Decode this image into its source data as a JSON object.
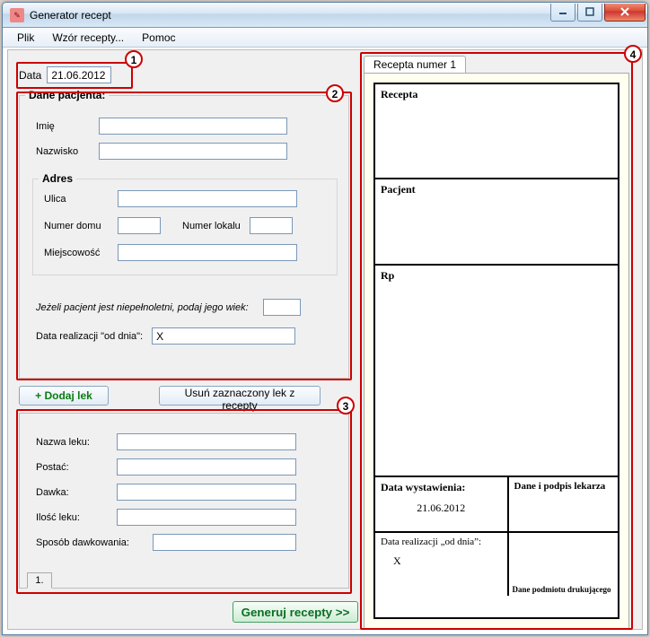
{
  "window": {
    "title": "Generator recept"
  },
  "menu": {
    "plik": "Plik",
    "wzor": "Wzór recepty...",
    "pomoc": "Pomoc"
  },
  "callouts": {
    "c1": "1",
    "c2": "2",
    "c3": "3",
    "c4": "4"
  },
  "date": {
    "label": "Data",
    "value": "21.06.2012"
  },
  "patient": {
    "legend": "Dane pacjenta:",
    "imie_label": "Imię",
    "imie": "",
    "nazwisko_label": "Nazwisko",
    "nazwisko": "",
    "adres_label": "Adres",
    "ulica_label": "Ulica",
    "ulica": "",
    "numer_domu_label": "Numer domu",
    "numer_domu": "",
    "numer_lokalu_label": "Numer lokalu",
    "numer_lokalu": "",
    "miejscowosc_label": "Miejscowość",
    "miejscowosc": "",
    "wiek_label": "Jeżeli pacjent jest niepełnoletni, podaj jego wiek:",
    "wiek": "",
    "realizacja_label": "Data realizacji \"od dnia\":",
    "realizacja": "X"
  },
  "buttons": {
    "dodaj": "+ Dodaj lek",
    "usun": "Usuń zaznaczony lek z recepty",
    "generuj": "Generuj recepty >>"
  },
  "med": {
    "nazwa_label": "Nazwa leku:",
    "nazwa": "",
    "postac_label": "Postać:",
    "postac": "",
    "dawka_label": "Dawka:",
    "dawka": "",
    "ilosc_label": "Ilość leku:",
    "ilosc": "",
    "sposob_label": "Sposób dawkowania:",
    "sposob": "",
    "tab": "1."
  },
  "preview": {
    "tab": "Recepta numer 1",
    "recepta": "Recepta",
    "pacjent": "Pacjent",
    "rp": "Rp",
    "data_wyst_label": "Data wystawienia:",
    "data_wyst": "21.06.2012",
    "dane_lekarza": "Dane i podpis lekarza",
    "data_real_label": "Data realizacji „od dnia”:",
    "data_real": "X",
    "dane_druk": "Dane podmiotu drukującego"
  }
}
